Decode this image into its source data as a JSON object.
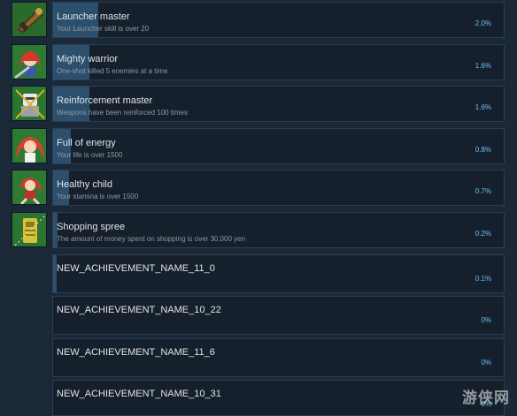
{
  "achievements": [
    {
      "title": "Launcher master",
      "desc": "Your Launcher skill is over 20",
      "percent": "2.0%",
      "fill": 0.02,
      "icon": "launcher-weapon-icon"
    },
    {
      "title": "Mighty warrior",
      "desc": "One-shot killed 5 enemies at a time",
      "percent": "1.6%",
      "fill": 0.016,
      "icon": "warrior-girl-icon"
    },
    {
      "title": "Reinforcement master",
      "desc": "Weapons have been reinforced 100 times",
      "percent": "1.6%",
      "fill": 0.016,
      "icon": "reinforce-robot-icon"
    },
    {
      "title": "Full of energy",
      "desc": "Your life is over 1500",
      "percent": "0.8%",
      "fill": 0.008,
      "icon": "energetic-girl-icon"
    },
    {
      "title": "Healthy child",
      "desc": "Your stamina is over 1500",
      "percent": "0.7%",
      "fill": 0.007,
      "icon": "running-girl-icon"
    },
    {
      "title": "Shopping spree",
      "desc": "The amount of money spent on shopping is over 30,000 yen",
      "percent": "0.2%",
      "fill": 0.002,
      "icon": "shopping-card-icon"
    },
    {
      "title": "NEW_ACHIEVEMENT_NAME_11_0",
      "desc": "",
      "percent": "0.1%",
      "fill": 0.001,
      "icon": ""
    },
    {
      "title": "NEW_ACHIEVEMENT_NAME_10_22",
      "desc": "",
      "percent": "0%",
      "fill": 0,
      "icon": ""
    },
    {
      "title": "NEW_ACHIEVEMENT_NAME_11_6",
      "desc": "",
      "percent": "0%",
      "fill": 0,
      "icon": ""
    },
    {
      "title": "NEW_ACHIEVEMENT_NAME_10_31",
      "desc": "",
      "percent": "0%",
      "fill": 0,
      "icon": ""
    }
  ],
  "watermark": "游侠网",
  "colors": {
    "background": "#1b2838",
    "card": "#16202d",
    "progress": "#2d4f6e",
    "percent_text": "#66c0f4"
  }
}
